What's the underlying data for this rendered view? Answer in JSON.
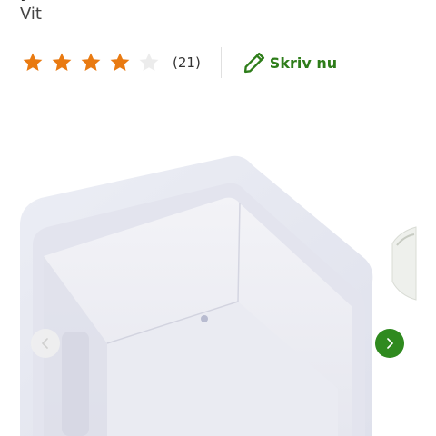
{
  "product": {
    "variant": "Vit"
  },
  "rating": {
    "value": 4,
    "max": 5,
    "count_label": "(21)",
    "star_color": "#e97a11",
    "empty_star_color": "#ececec"
  },
  "review": {
    "write_label": "Skriv nu",
    "icon": "pencil-icon",
    "accent_color": "#2e7d1a"
  },
  "gallery": {
    "prev_icon": "chevron-left-icon",
    "next_icon": "chevron-right-icon",
    "next_button_color": "#2f8a1f"
  }
}
